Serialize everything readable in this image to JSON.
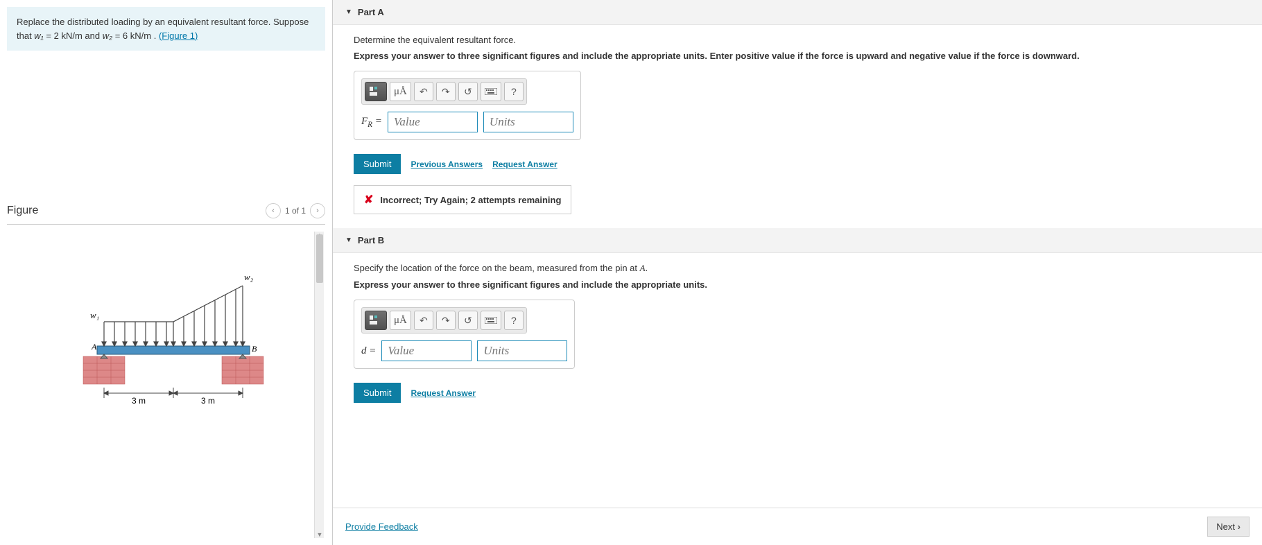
{
  "problem": {
    "text_prefix": "Replace the distributed loading by an equivalent resultant force. Suppose that ",
    "w1_var": "w₁",
    "w1_eq": " = 2  kN/m",
    "and": " and ",
    "w2_var": "w₂",
    "w2_eq": " = 6  kN/m",
    "period": " . ",
    "figure_link": "(Figure 1)"
  },
  "figure": {
    "title": "Figure",
    "nav_text": "1 of 1",
    "labels": {
      "w1": "w₁",
      "w2": "w₂",
      "A": "A",
      "B": "B",
      "dim": "3 m"
    }
  },
  "partA": {
    "title": "Part A",
    "instruction": "Determine the equivalent resultant force.",
    "bold_instruction": "Express your answer to three significant figures and include the appropriate units. Enter positive value if the force is upward and negative value if the force is downward.",
    "var_label": "F",
    "var_sub": "R",
    "equals": " =",
    "value_ph": "Value",
    "units_ph": "Units",
    "submit": "Submit",
    "prev_answers": "Previous Answers",
    "request_answer": "Request Answer",
    "feedback": "Incorrect; Try Again; 2 attempts remaining"
  },
  "partB": {
    "title": "Part B",
    "instruction_prefix": "Specify the location of the force on the beam, measured from the pin at ",
    "instruction_var": "A",
    "instruction_suffix": ".",
    "bold_instruction": "Express your answer to three significant figures and include the appropriate units.",
    "var_label": "d",
    "equals": " =",
    "value_ph": "Value",
    "units_ph": "Units",
    "submit": "Submit",
    "request_answer": "Request Answer"
  },
  "toolbar": {
    "units_label": "μÅ",
    "help": "?"
  },
  "footer": {
    "provide_feedback": "Provide Feedback",
    "next": "Next"
  }
}
